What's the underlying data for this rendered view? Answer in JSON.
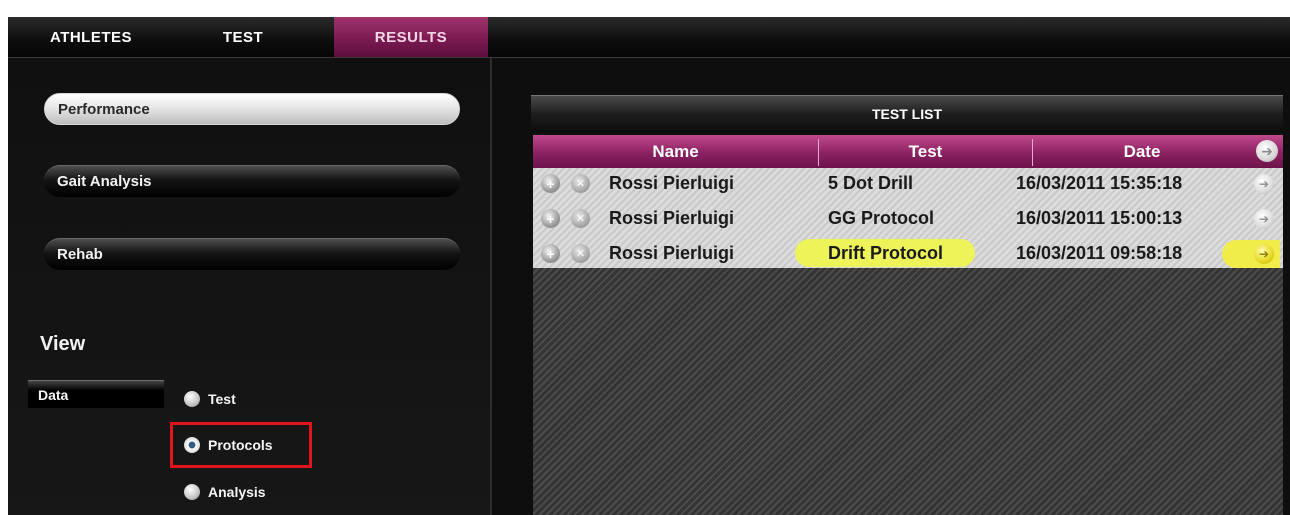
{
  "nav": {
    "tabs": [
      {
        "label": "ATHLETES"
      },
      {
        "label": "TEST"
      },
      {
        "label": "RESULTS"
      }
    ]
  },
  "left": {
    "buttons": [
      {
        "label": "Performance"
      },
      {
        "label": "Gait Analysis"
      },
      {
        "label": "Rehab"
      }
    ],
    "view_title": "View",
    "data_label": "Data",
    "radios": [
      {
        "label": "Test"
      },
      {
        "label": "Protocols"
      },
      {
        "label": "Analysis"
      }
    ]
  },
  "test_list": {
    "title": "TEST LIST",
    "columns": [
      "Name",
      "Test",
      "Date"
    ],
    "rows": [
      {
        "name": "Rossi Pierluigi",
        "test": "5 Dot Drill",
        "date": "16/03/2011 15:35:18"
      },
      {
        "name": "Rossi Pierluigi",
        "test": "GG Protocol",
        "date": "16/03/2011 15:00:13"
      },
      {
        "name": "Rossi Pierluigi",
        "test": "Drift Protocol",
        "date": "16/03/2011 09:58:18"
      }
    ]
  },
  "colors": {
    "accent_magenta": "#8b2162",
    "highlight_yellow": "#eef35a",
    "annotation_red": "#e0141c"
  }
}
